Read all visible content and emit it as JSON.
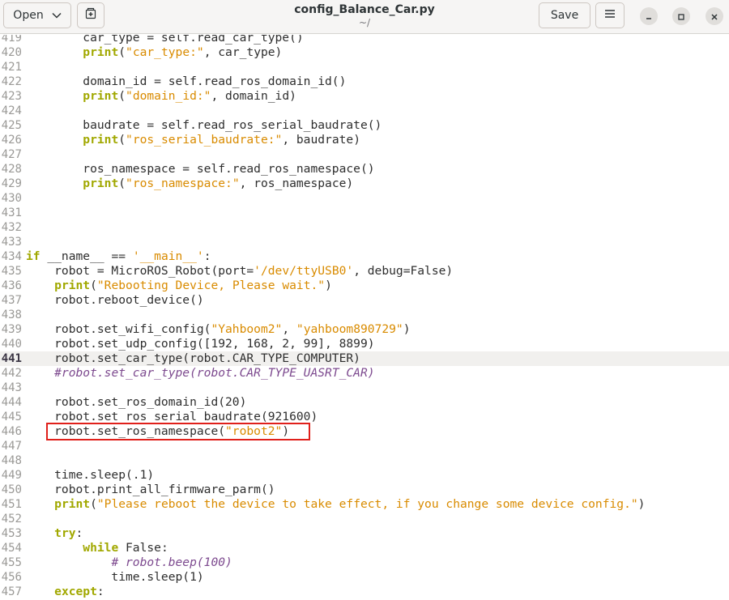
{
  "header": {
    "open_label": "Open",
    "title": "config_Balance_Car.py",
    "subtitle": "~/",
    "save_label": "Save"
  },
  "icons": {
    "open_dropdown": "chevron-down-icon",
    "new_tab": "new-tab-icon",
    "menu": "hamburger-menu-icon",
    "minimize": "minimize-icon",
    "maximize": "maximize-icon",
    "close": "close-icon"
  },
  "colors": {
    "keyword": "#a1a800",
    "string": "#d98b00",
    "comment": "#7d4a8f",
    "highlight_box": "#e0201b"
  },
  "editor": {
    "current_line": 441,
    "lines": [
      {
        "n": "419",
        "tokens": [
          [
            "t",
            "        car_type = self.read_car_type()"
          ]
        ]
      },
      {
        "n": "420",
        "tokens": [
          [
            "t",
            "        "
          ],
          [
            "f",
            "print"
          ],
          [
            "t",
            "("
          ],
          [
            "s",
            "\"car_type:\""
          ],
          [
            "t",
            ", car_type)"
          ]
        ]
      },
      {
        "n": "421",
        "tokens": []
      },
      {
        "n": "422",
        "tokens": [
          [
            "t",
            "        domain_id = self.read_ros_domain_id()"
          ]
        ]
      },
      {
        "n": "423",
        "tokens": [
          [
            "t",
            "        "
          ],
          [
            "f",
            "print"
          ],
          [
            "t",
            "("
          ],
          [
            "s",
            "\"domain_id:\""
          ],
          [
            "t",
            ", domain_id)"
          ]
        ]
      },
      {
        "n": "424",
        "tokens": []
      },
      {
        "n": "425",
        "tokens": [
          [
            "t",
            "        baudrate = self.read_ros_serial_baudrate()"
          ]
        ]
      },
      {
        "n": "426",
        "tokens": [
          [
            "t",
            "        "
          ],
          [
            "f",
            "print"
          ],
          [
            "t",
            "("
          ],
          [
            "s",
            "\"ros_serial_baudrate:\""
          ],
          [
            "t",
            ", baudrate)"
          ]
        ]
      },
      {
        "n": "427",
        "tokens": []
      },
      {
        "n": "428",
        "tokens": [
          [
            "t",
            "        ros_namespace = self.read_ros_namespace()"
          ]
        ]
      },
      {
        "n": "429",
        "tokens": [
          [
            "t",
            "        "
          ],
          [
            "f",
            "print"
          ],
          [
            "t",
            "("
          ],
          [
            "s",
            "\"ros_namespace:\""
          ],
          [
            "t",
            ", ros_namespace)"
          ]
        ]
      },
      {
        "n": "430",
        "tokens": []
      },
      {
        "n": "431",
        "tokens": []
      },
      {
        "n": "432",
        "tokens": []
      },
      {
        "n": "433",
        "tokens": []
      },
      {
        "n": "434",
        "tokens": [
          [
            "k",
            "if"
          ],
          [
            "t",
            " __name__ == "
          ],
          [
            "s",
            "'__main__'"
          ],
          [
            "t",
            ":"
          ]
        ]
      },
      {
        "n": "435",
        "tokens": [
          [
            "t",
            "    robot = MicroROS_Robot(port="
          ],
          [
            "s",
            "'/dev/ttyUSB0'"
          ],
          [
            "t",
            ", debug=False)"
          ]
        ]
      },
      {
        "n": "436",
        "tokens": [
          [
            "t",
            "    "
          ],
          [
            "f",
            "print"
          ],
          [
            "t",
            "("
          ],
          [
            "s",
            "\"Rebooting Device, Please wait.\""
          ],
          [
            "t",
            ")"
          ]
        ]
      },
      {
        "n": "437",
        "tokens": [
          [
            "t",
            "    robot.reboot_device()"
          ]
        ]
      },
      {
        "n": "438",
        "tokens": []
      },
      {
        "n": "439",
        "tokens": [
          [
            "t",
            "    robot.set_wifi_config("
          ],
          [
            "s",
            "\"Yahboom2\""
          ],
          [
            "t",
            ", "
          ],
          [
            "s",
            "\"yahboom890729\""
          ],
          [
            "t",
            ")"
          ]
        ]
      },
      {
        "n": "440",
        "tokens": [
          [
            "t",
            "    robot.set_udp_config([192, 168, 2, 99], 8899)"
          ]
        ]
      },
      {
        "n": "441",
        "tokens": [
          [
            "t",
            "    robot.set_car_type(robot.CAR_TYPE_COMPUTER)"
          ]
        ]
      },
      {
        "n": "442",
        "tokens": [
          [
            "t",
            "    "
          ],
          [
            "c",
            "#robot.set_car_type(robot.CAR_TYPE_UASRT_CAR)"
          ]
        ]
      },
      {
        "n": "443",
        "tokens": []
      },
      {
        "n": "444",
        "tokens": [
          [
            "t",
            "    robot.set_ros_domain_id(20)"
          ]
        ]
      },
      {
        "n": "445",
        "tokens": [
          [
            "t",
            "    robot.set_ros_serial_baudrate(921600)"
          ]
        ]
      },
      {
        "n": "446",
        "tokens": [
          [
            "t",
            "    robot.set_ros_namespace("
          ],
          [
            "s",
            "\"robot2\""
          ],
          [
            "t",
            ")"
          ]
        ]
      },
      {
        "n": "447",
        "tokens": []
      },
      {
        "n": "448",
        "tokens": []
      },
      {
        "n": "449",
        "tokens": [
          [
            "t",
            "    time.sleep(.1)"
          ]
        ]
      },
      {
        "n": "450",
        "tokens": [
          [
            "t",
            "    robot.print_all_firmware_parm()"
          ]
        ]
      },
      {
        "n": "451",
        "tokens": [
          [
            "t",
            "    "
          ],
          [
            "f",
            "print"
          ],
          [
            "t",
            "("
          ],
          [
            "s",
            "\"Please reboot the device to take effect, if you change some device config.\""
          ],
          [
            "t",
            ")"
          ]
        ]
      },
      {
        "n": "452",
        "tokens": []
      },
      {
        "n": "453",
        "tokens": [
          [
            "t",
            "    "
          ],
          [
            "k",
            "try"
          ],
          [
            "t",
            ":"
          ]
        ]
      },
      {
        "n": "454",
        "tokens": [
          [
            "t",
            "        "
          ],
          [
            "k",
            "while"
          ],
          [
            "t",
            " False:"
          ]
        ]
      },
      {
        "n": "455",
        "tokens": [
          [
            "t",
            "            "
          ],
          [
            "c",
            "# robot.beep(100)"
          ]
        ]
      },
      {
        "n": "456",
        "tokens": [
          [
            "t",
            "            time.sleep(1)"
          ]
        ]
      },
      {
        "n": "457",
        "tokens": [
          [
            "t",
            "    "
          ],
          [
            "k",
            "except"
          ],
          [
            "t",
            ":"
          ]
        ]
      }
    ]
  }
}
